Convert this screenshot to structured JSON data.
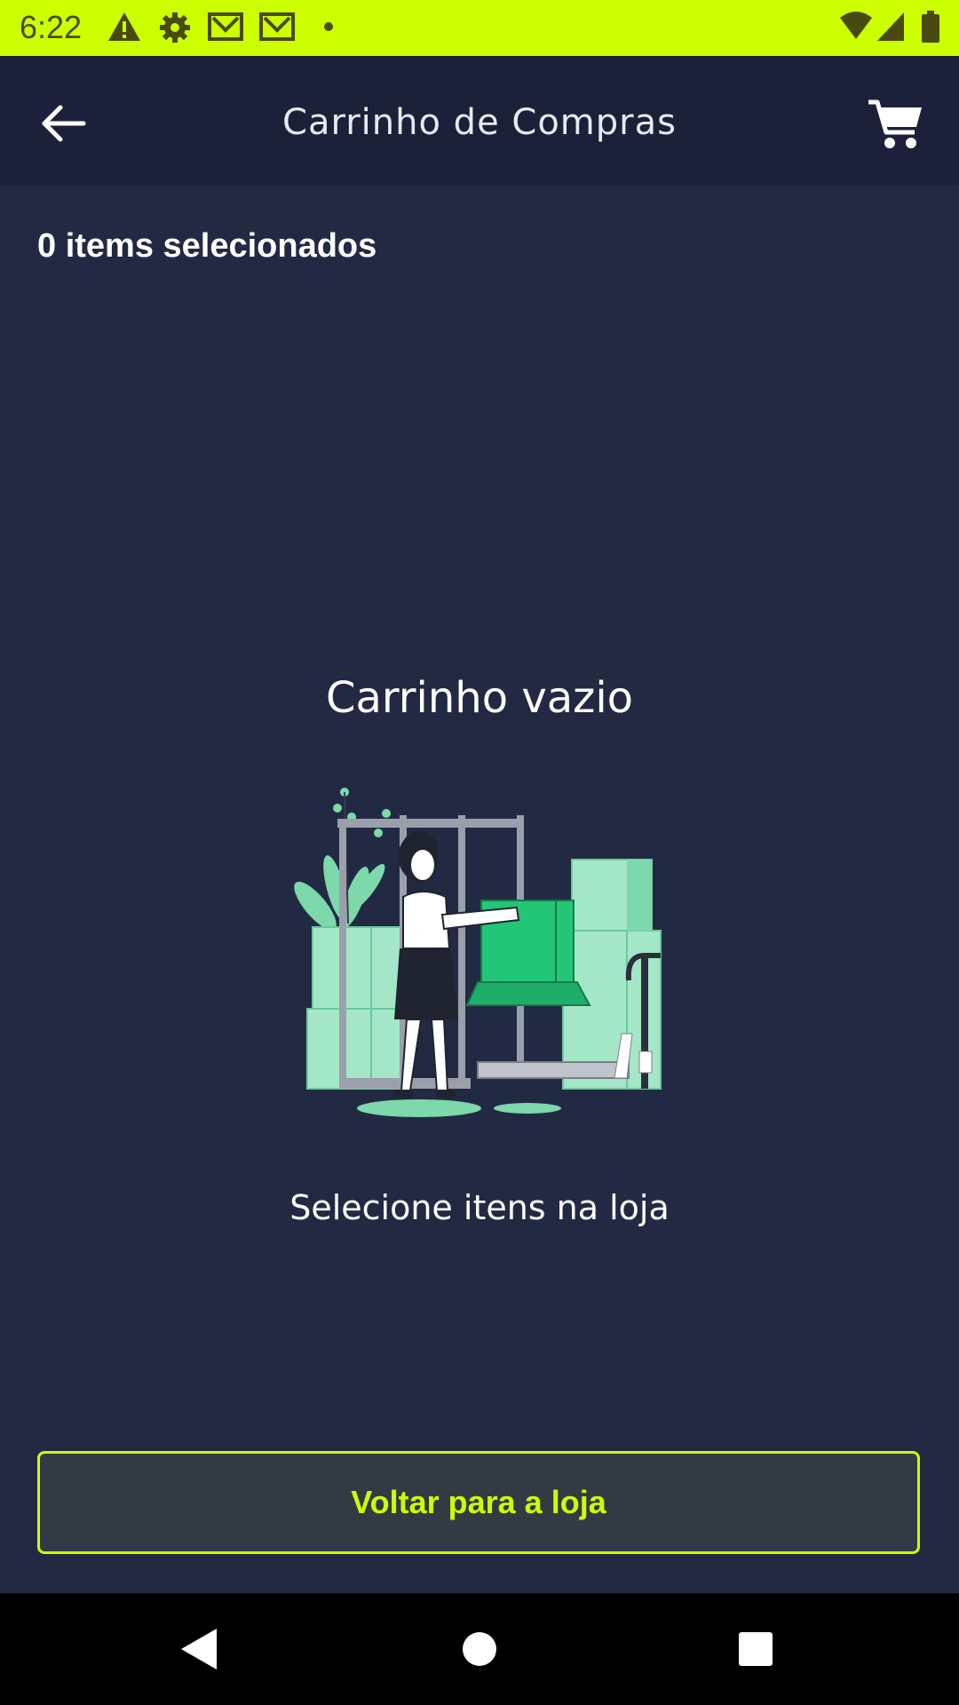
{
  "status_bar": {
    "time": "6:22",
    "icons_left": [
      "warning-icon",
      "settings-icon",
      "gmail-icon",
      "gmail-icon",
      "dot-icon"
    ],
    "icons_right": [
      "wifi-icon",
      "signal-icon",
      "battery-icon"
    ],
    "background": "#ccff00"
  },
  "app_bar": {
    "title": "Carrinho de Compras",
    "back_icon": "arrow-left-icon",
    "cart_icon": "cart-icon"
  },
  "cart": {
    "items_count_label": "0 items selecionados",
    "empty_title": "Carrinho vazio",
    "empty_subtitle": "Selecione itens na loja",
    "illustration": "woman-carrying-box-illustration"
  },
  "actions": {
    "back_to_store_label": "Voltar para a loja"
  },
  "nav_bar": {
    "buttons": [
      "back-triangle-icon",
      "home-circle-icon",
      "recents-square-icon"
    ]
  },
  "colors": {
    "accent": "#ccff00",
    "background": "#222a43",
    "app_bar": "#1b2139",
    "button_bg": "#323b44",
    "illustration_green": "#23c576",
    "illustration_light_green": "#a4e7c8"
  }
}
